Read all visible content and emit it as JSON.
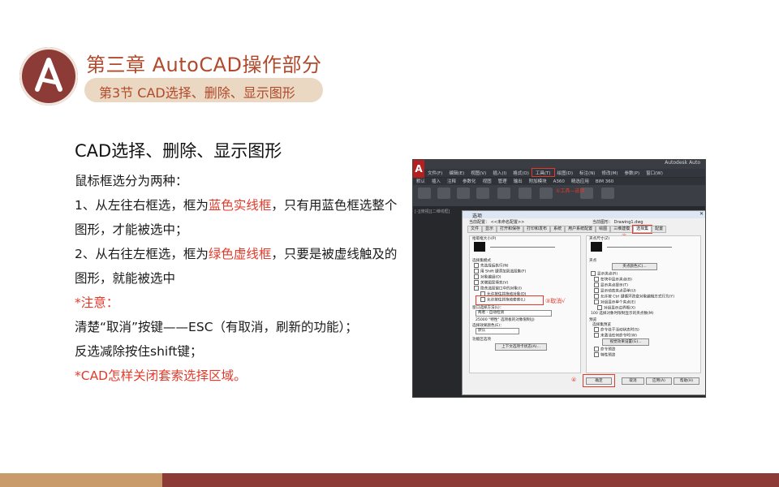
{
  "header": {
    "chapter_title": "第三章    AutoCAD操作部分",
    "section_title": "第3节   CAD选择、删除、显示图形",
    "logo_icon": "letter-a-logo"
  },
  "content": {
    "heading": "CAD选择、删除、显示图形",
    "intro": "鼠标框选分为两种：",
    "item1_a": "1、从左往右框选，框为",
    "item1_hl": "蓝色实线框",
    "item1_b": "，只有用蓝色框选整个图形，才能被选中；",
    "item2_a": "2、从右往左框选，框为",
    "item2_hl": "绿色虚线框",
    "item2_b": "，只要是被虚线触及的图形，就能被选中",
    "note_label": "*注意：",
    "note1": "清楚“取消”按键——ESC（有取消，刷新的功能）；",
    "note2": "反选减除按住shift键；",
    "note3": "*CAD怎样关闭套索选择区域。"
  },
  "screenshot": {
    "app_title": "Autodesk Auto",
    "menu": [
      "文件(F)",
      "编辑(E)",
      "视图(V)",
      "插入(I)",
      "格式(O)",
      "工具(T)",
      "绘图(D)",
      "标注(N)",
      "修改(M)",
      "参数(P)",
      "窗口(W)"
    ],
    "ribbon_tabs": [
      "默认",
      "插入",
      "注释",
      "参数化",
      "视图",
      "管理",
      "输出",
      "附加模块",
      "A360",
      "精选应用",
      "BIM 360"
    ],
    "toolbar_note": "①工具—选项",
    "view_label": "[-][俯视][二维线框]",
    "dialog": {
      "title": "选项",
      "current_config_label": "当前配置：",
      "current_config_value": "<<未命名配置>>",
      "current_drawing_label": "当前图形：",
      "current_drawing_value": "Drawing1.dwg",
      "tabs": [
        "文件",
        "显示",
        "打开和保存",
        "打印和发布",
        "系统",
        "用户系统配置",
        "绘图",
        "三维建模",
        "选择集",
        "配置"
      ],
      "active_tab": "选择集",
      "pickbox_label": "拾取框大小(P)",
      "grip_size_label": "夹点尺寸(Z)",
      "selection_mode_label": "选择集模式",
      "modes": [
        "先选择后执行(N)",
        "用 Shift 键添加到选择集(F)",
        "对象编组(O)",
        "关联图案填充(V)",
        "隐含选择窗口中的对象(I)",
        "允许按住并拖动对象(D)",
        "允许按住并拖动套索(L)"
      ],
      "window_type_label": "窗口选择方法(L)：",
      "window_type_value": "两者 - 自动检测",
      "props_limit_value": "25000",
      "props_limit_label": "\"特性\" 选项板的对象限制(J)",
      "preview_color_label": "选择效果颜色(E)：",
      "preview_color_value": "默认",
      "ribbon_options_label": "功能区选项",
      "context_tab_button": "上下文选项卡状态(A)...",
      "grips_label": "夹点",
      "grip_color_button": "夹点颜色(C)...",
      "grip_options": [
        "显示夹点(R)",
        "在块中显示夹点(B)",
        "显示夹点提示(T)",
        "显示动态夹点菜单(U)",
        "允许按 Ctrl 键循环改变对象编辑方式行为(Y)",
        "对组显示单个夹点(E)",
        "对组显示边界框(X)"
      ],
      "grip_limit_value": "100",
      "grip_limit_label": "选择对象时限制显示的夹点数(M)",
      "preview_label": "预览",
      "preview_group_label": "选择集预览",
      "preview_options": [
        "命令处于活动状态时(S)",
        "未激活任何命令时(W)"
      ],
      "visual_effects_button": "视觉效果设置(G)...",
      "preview_extra": [
        "命令预览",
        "特性预览"
      ],
      "ok": "确定",
      "cancel": "取消",
      "apply": "应用(A)",
      "help": "帮助(H)"
    },
    "notes": {
      "n2": "②",
      "n3": "③取消√",
      "n4": "④"
    }
  },
  "colors": {
    "accent_red": "#b1492b",
    "highlight_red": "#e23a2a",
    "logo_bg": "#8c3b37",
    "section_bar": "#ead8c3",
    "footer_left": "#c99a6a",
    "footer_right": "#8c3b37"
  }
}
